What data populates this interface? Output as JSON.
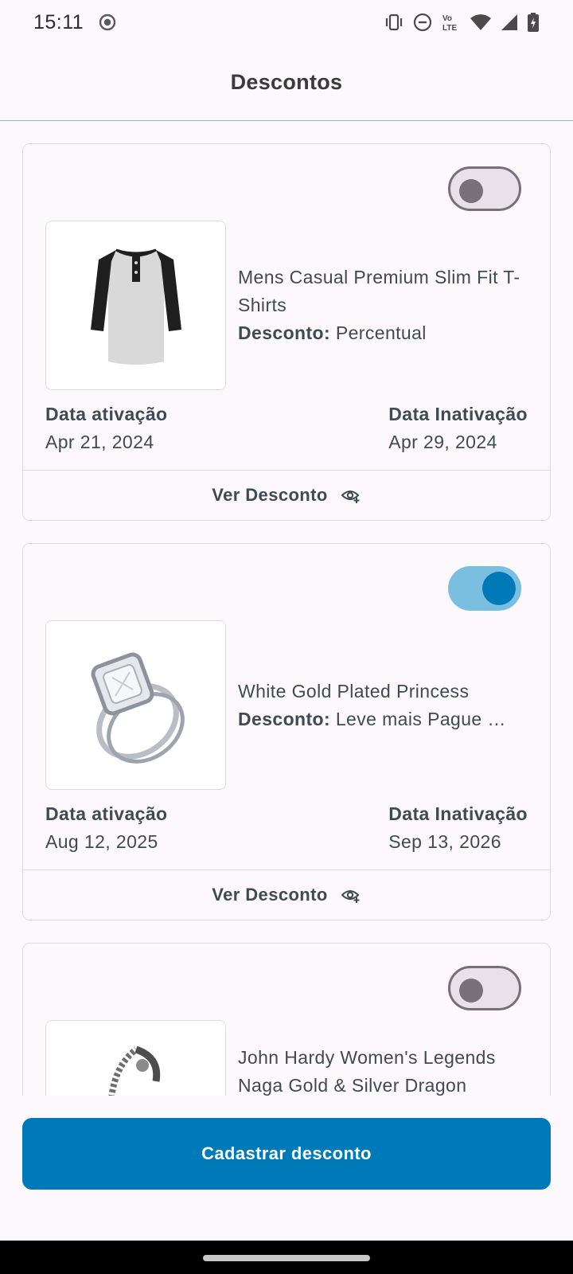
{
  "status_bar": {
    "time": "15:11",
    "icons": [
      "record-icon",
      "vibrate-icon",
      "do-not-disturb-icon",
      "volte-icon",
      "wifi-icon",
      "signal-icon",
      "battery-icon"
    ],
    "volte_text_top": "Vo",
    "volte_text_bottom": "LTE"
  },
  "header": {
    "title": "Descontos"
  },
  "discounts": [
    {
      "name": "Mens Casual Premium Slim Fit T-Shirts",
      "discount_label": "Desconto:",
      "discount_type": "Percentual",
      "active": false,
      "activation_label": "Data ativação",
      "activation_date": "Apr 21, 2024",
      "inactivation_label": "Data Inativação",
      "inactivation_date": "Apr 29, 2024",
      "action_label": "Ver Desconto",
      "image_icon": "shirt-icon"
    },
    {
      "name": "White Gold Plated Princess",
      "discount_label": "Desconto:",
      "discount_type": "Leve mais Pague …",
      "active": true,
      "activation_label": "Data ativação",
      "activation_date": "Aug 12, 2025",
      "inactivation_label": "Data Inativação",
      "inactivation_date": "Sep 13, 2026",
      "action_label": "Ver Desconto",
      "image_icon": "ring-icon"
    },
    {
      "name": "John Hardy Women's Legends Naga Gold & Silver Dragon",
      "active": false,
      "image_icon": "bracelet-icon"
    }
  ],
  "primary_button": {
    "label": "Cadastrar desconto"
  },
  "colors": {
    "accent": "#0079b8",
    "toggle_on_track": "#7bbfe0",
    "toggle_off_track": "#e8e1ea",
    "toggle_off_knob": "#787079",
    "text": "#3e4b52",
    "background": "#fdf8fc"
  }
}
